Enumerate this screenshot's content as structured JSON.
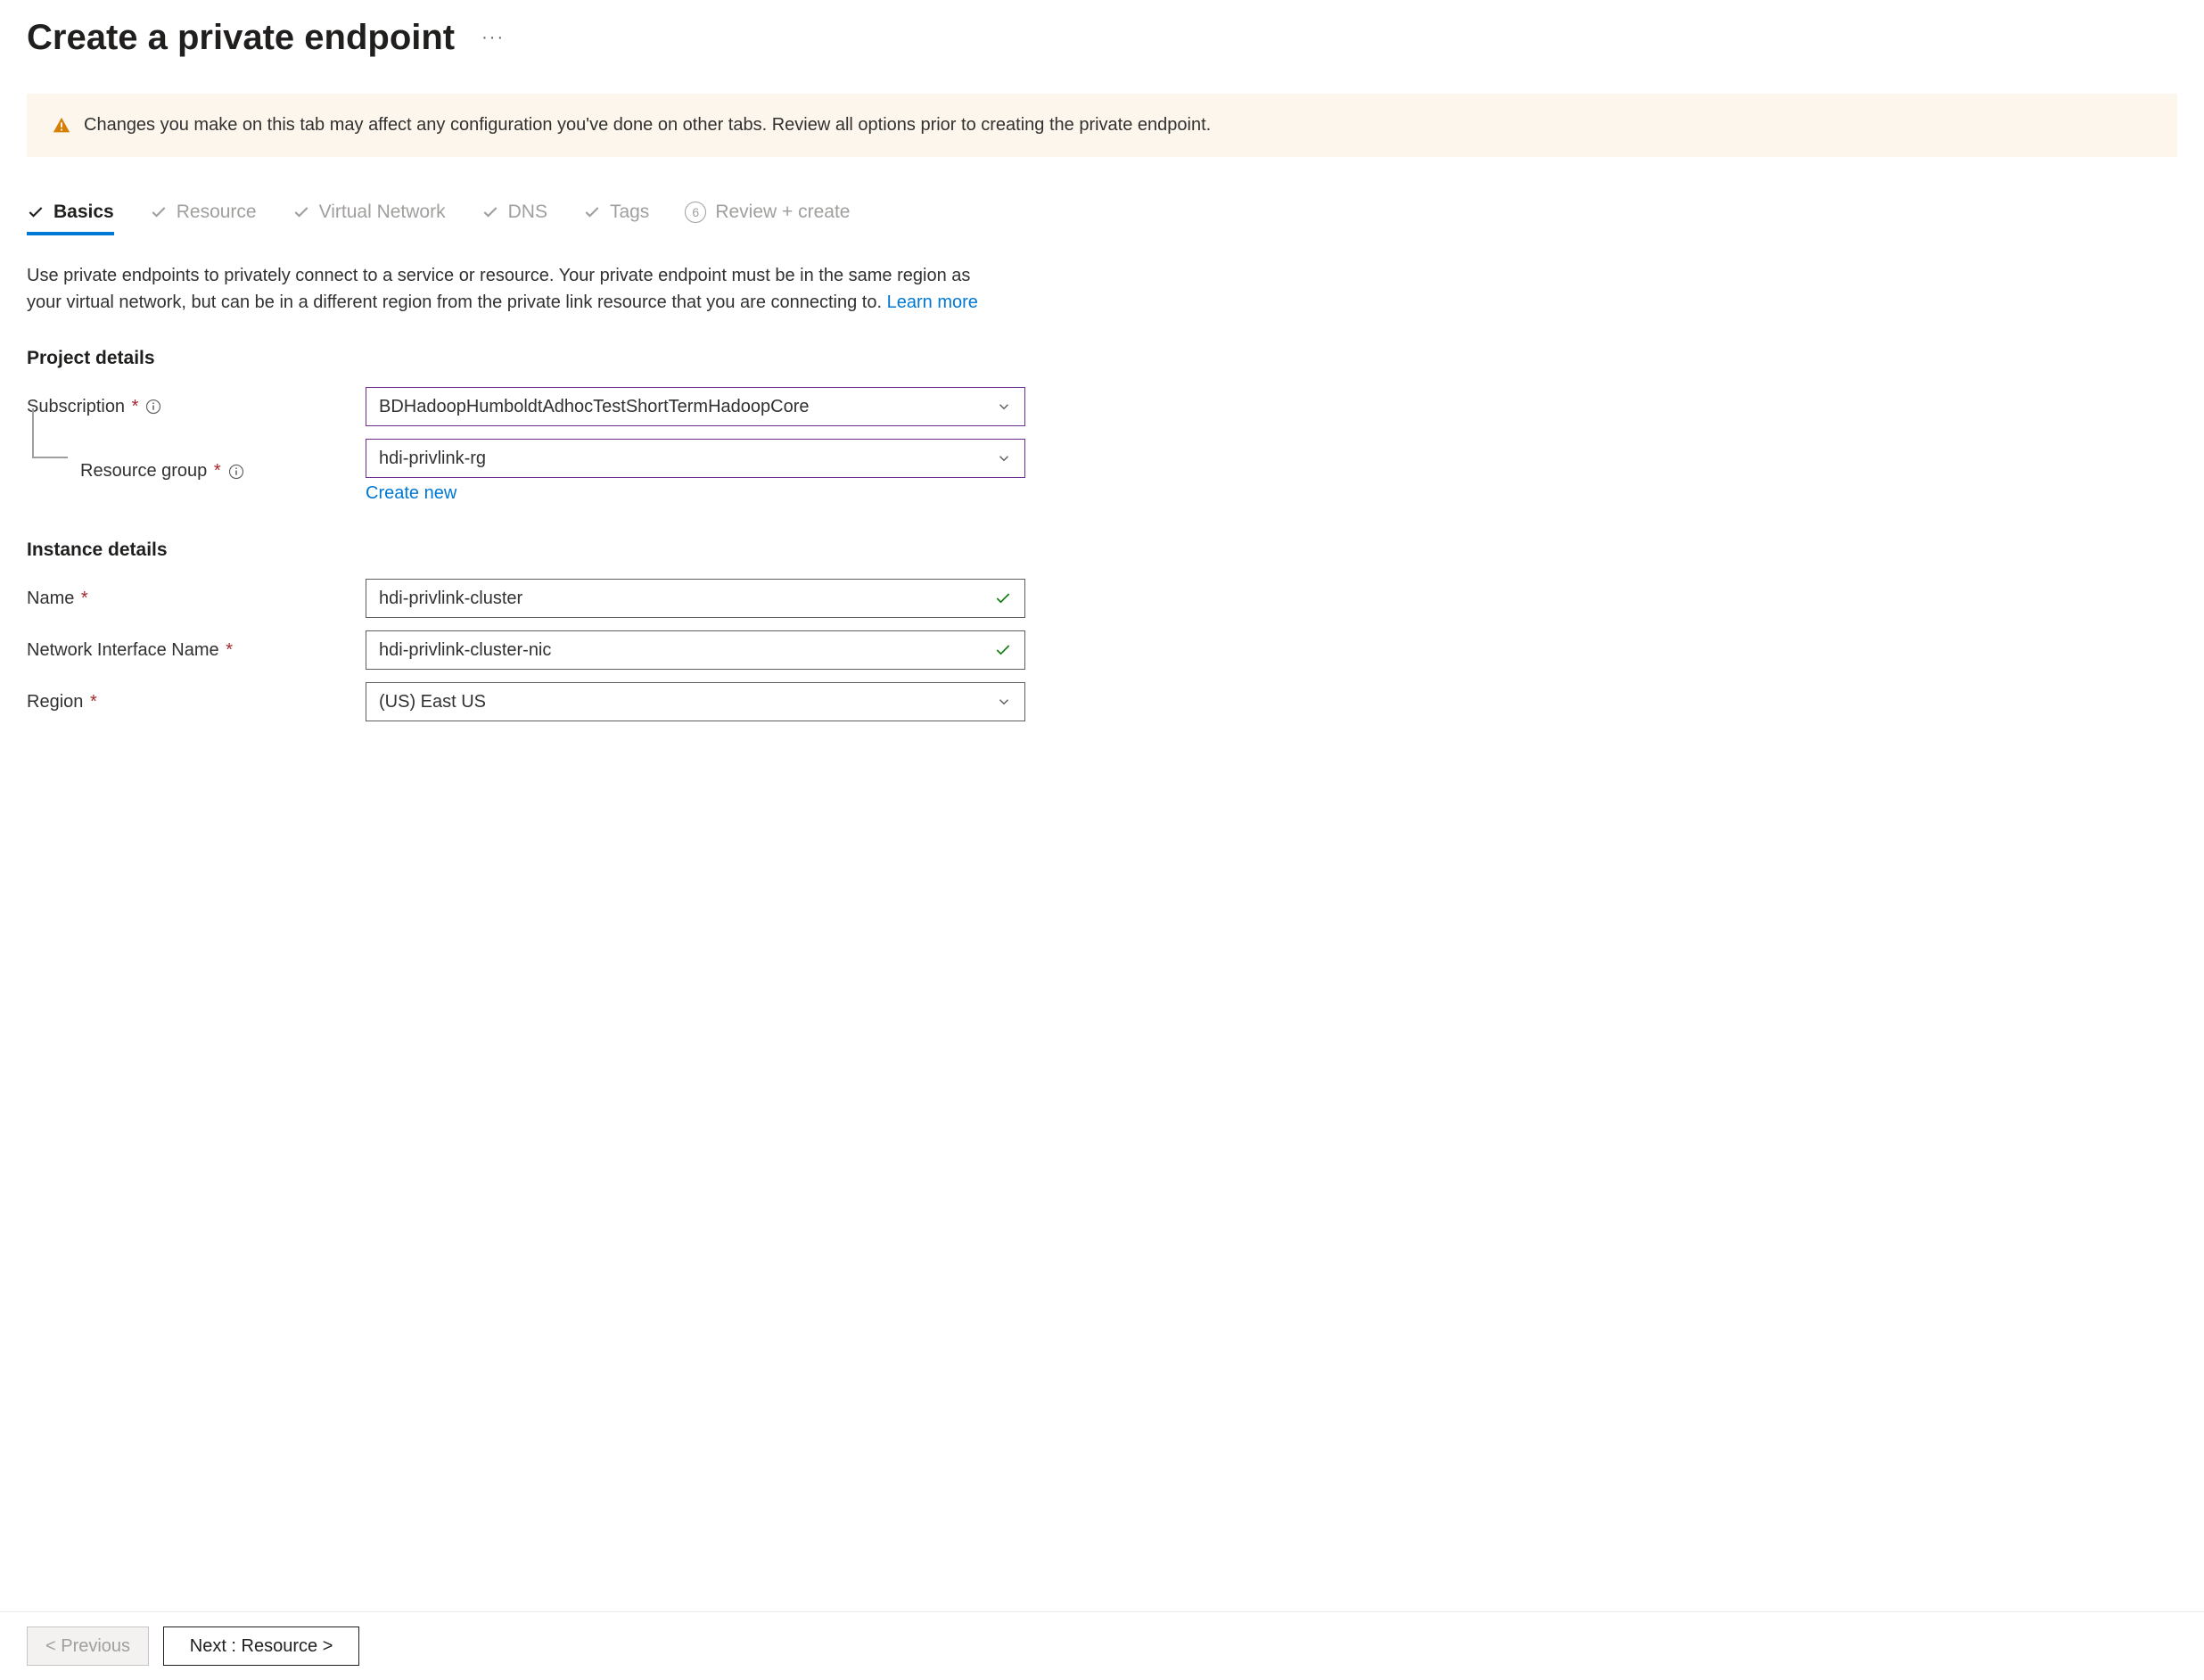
{
  "header": {
    "title": "Create a private endpoint",
    "more": "···"
  },
  "warning": {
    "text": "Changes you make on this tab may affect any configuration you've done on other tabs. Review all options prior to creating the private endpoint."
  },
  "tabs": {
    "basics": "Basics",
    "resource": "Resource",
    "virtual_network": "Virtual Network",
    "dns": "DNS",
    "tags": "Tags",
    "review_number": "6",
    "review": "Review + create"
  },
  "description": {
    "text": "Use private endpoints to privately connect to a service or resource. Your private endpoint must be in the same region as your virtual network, but can be in a different region from the private link resource that you are connecting to.  ",
    "learn_more": "Learn more"
  },
  "sections": {
    "project_title": "Project details",
    "instance_title": "Instance details"
  },
  "form": {
    "subscription": {
      "label": "Subscription",
      "value": "BDHadoopHumboldtAdhocTestShortTermHadoopCore"
    },
    "resource_group": {
      "label": "Resource group",
      "value": "hdi-privlink-rg",
      "create_new": "Create new"
    },
    "name": {
      "label": "Name",
      "value": "hdi-privlink-cluster"
    },
    "nic_name": {
      "label": "Network Interface Name",
      "value": "hdi-privlink-cluster-nic"
    },
    "region": {
      "label": "Region",
      "value": "(US) East US"
    }
  },
  "footer": {
    "previous": "< Previous",
    "next": "Next : Resource >"
  }
}
